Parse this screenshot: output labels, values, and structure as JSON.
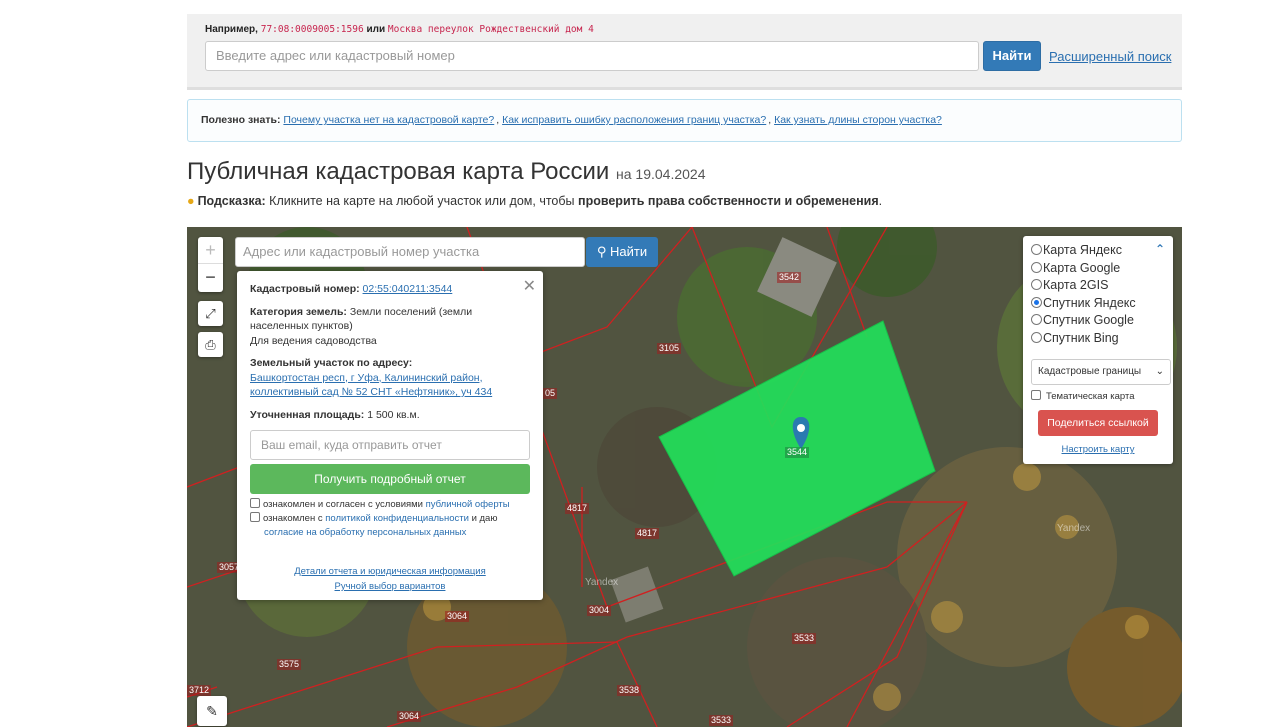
{
  "search": {
    "example_prefix": "Например,",
    "example_code1": "77:08:0009005:1596",
    "example_or": "или",
    "example_code2": "Москва переулок Рождественский дом 4",
    "placeholder": "Введите адрес или кадастровый номер",
    "button": "Найти",
    "advanced": "Расширенный поиск"
  },
  "info": {
    "prefix": "Полезно знать:",
    "links": [
      "Почему участка нет на кадастровой карте?",
      "Как исправить ошибку расположения границ участка?",
      "Как узнать длины сторон участка?"
    ]
  },
  "page": {
    "title": "Публичная кадастровая карта России",
    "date": "на 19.04.2024",
    "hint_label": "Подсказка:",
    "hint_text": "Кликните на карте на любой участок или дом, чтобы",
    "hint_bold": "проверить права собственности и обременения",
    "hint_end": "."
  },
  "map": {
    "zoom_in": "+",
    "zoom_out": "−",
    "search_placeholder": "Адрес или кадастровый номер участка",
    "search_button": "Найти",
    "watermark": "Yandex",
    "lot_labels": [
      "3542",
      "3105",
      "4817",
      "4817",
      "3057",
      "3064",
      "3004",
      "3575",
      "3712",
      "3538",
      "3533",
      "3064",
      "3533",
      "3544",
      "05"
    ]
  },
  "popup": {
    "cad_label": "Кадастровый номер:",
    "cad_value": "02:55:040211:3544",
    "cat_label": "Категория земель:",
    "cat_value": "Земли поселений (земли населенных пунктов)",
    "use": "Для ведения садоводства",
    "addr_label": "Земельный участок по адресу:",
    "addr_value": "Башкортостан респ, г Уфа, Калининский район, коллективный сад № 52 СНТ «Нефтяник», уч 434",
    "area_label": "Уточненная площадь:",
    "area_value": "1 500 кв.м.",
    "email_placeholder": "Ваш email, куда отправить отчет",
    "report_button": "Получить подробный отчет",
    "consent1_text": "ознакомлен и согласен с условиями",
    "consent1_link": "публичной оферты",
    "consent2_text": "ознакомлен с",
    "consent2_link": "политикой конфиденциальности",
    "consent2_mid": "и даю",
    "consent2_link2": "согласие на обработку персональных данных",
    "details_link": "Детали отчета и юридическая информация",
    "manual_link": "Ручной выбор вариантов"
  },
  "layers": {
    "options": [
      "Карта Яндекс",
      "Карта Google",
      "Карта 2GIS",
      "Спутник Яндекс",
      "Спутник Google",
      "Спутник Bing"
    ],
    "selected": "Спутник Яндекс",
    "overlay_select": "Кадастровые границы",
    "thematic": "Тематическая карта",
    "share": "Поделиться ссылкой",
    "configure": "Настроить карту"
  },
  "colors": {
    "primary": "#337ab7",
    "success": "#5cb85c",
    "danger": "#d9534f",
    "parcel": "#22e05a",
    "boundary": "#d02020"
  }
}
